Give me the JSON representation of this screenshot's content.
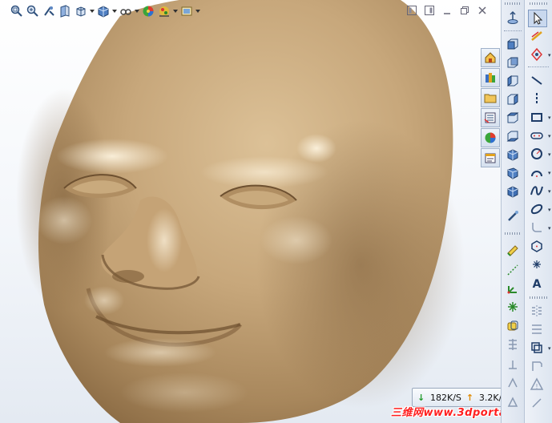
{
  "hud_toolbar": {
    "items": [
      {
        "icon": "zoom-to-fit-icon",
        "dropdown": false
      },
      {
        "icon": "zoom-to-area-icon",
        "dropdown": false
      },
      {
        "icon": "previous-view-icon",
        "dropdown": false
      },
      {
        "icon": "section-view-icon",
        "dropdown": false
      },
      {
        "icon": "view-orientation-icon",
        "dropdown": true
      },
      {
        "icon": "display-style-icon",
        "dropdown": true
      },
      {
        "icon": "hide-show-items-icon",
        "dropdown": true
      },
      {
        "icon": "edit-appearance-icon",
        "dropdown": false
      },
      {
        "icon": "apply-scene-icon",
        "dropdown": true
      },
      {
        "icon": "view-settings-icon",
        "dropdown": true
      }
    ]
  },
  "window_controls": [
    "tile-horizontal-icon",
    "tile-vertical-icon",
    "restore-icon",
    "maximize-icon",
    "close-icon"
  ],
  "task_pane": {
    "tabs": [
      "solidworks-resources-icon",
      "design-library-icon",
      "file-explorer-icon",
      "view-palette-icon",
      "appearances-scenes-icon",
      "custom-properties-icon"
    ]
  },
  "view_toolbar": {
    "items": [
      "normal-to-icon",
      "front-view-icon",
      "back-view-icon",
      "left-view-icon",
      "right-view-icon",
      "top-view-icon",
      "bottom-view-icon",
      "isometric-view-icon",
      "trimetric-view-icon",
      "dimetric-view-icon",
      "view-selector-icon",
      "section-properties-icon",
      "origin-icon",
      "reference-geometry-icon",
      "explode-line-icon",
      "sketch-point-icon",
      "extend-icon",
      "sketch-fillet-icon",
      "sketch-chamfer-icon"
    ]
  },
  "sketch_toolbar": {
    "items": [
      "select-icon",
      "smart-dimension-icon",
      "sketch-icon",
      "line-icon",
      "centerline-icon",
      "rectangle-icon",
      "slot-icon",
      "circle-icon",
      "arc-icon",
      "spline-icon",
      "ellipse-icon",
      "fillet-icon",
      "polygon-icon",
      "point-icon",
      "text-icon",
      "mirror-icon",
      "linear-pattern-icon",
      "offset-icon",
      "convert-entities-icon",
      "trim-icon",
      "relations-icon"
    ]
  },
  "network_monitor": {
    "download_speed": "182K/S",
    "upload_speed": "3.2K/S"
  },
  "watermark": {
    "text": "三维网www.3dportal.cn"
  },
  "colors": {
    "model_skin": "#c4a47a",
    "model_shadow": "#8f6f47",
    "watermark_red": "#ff1f1f"
  }
}
